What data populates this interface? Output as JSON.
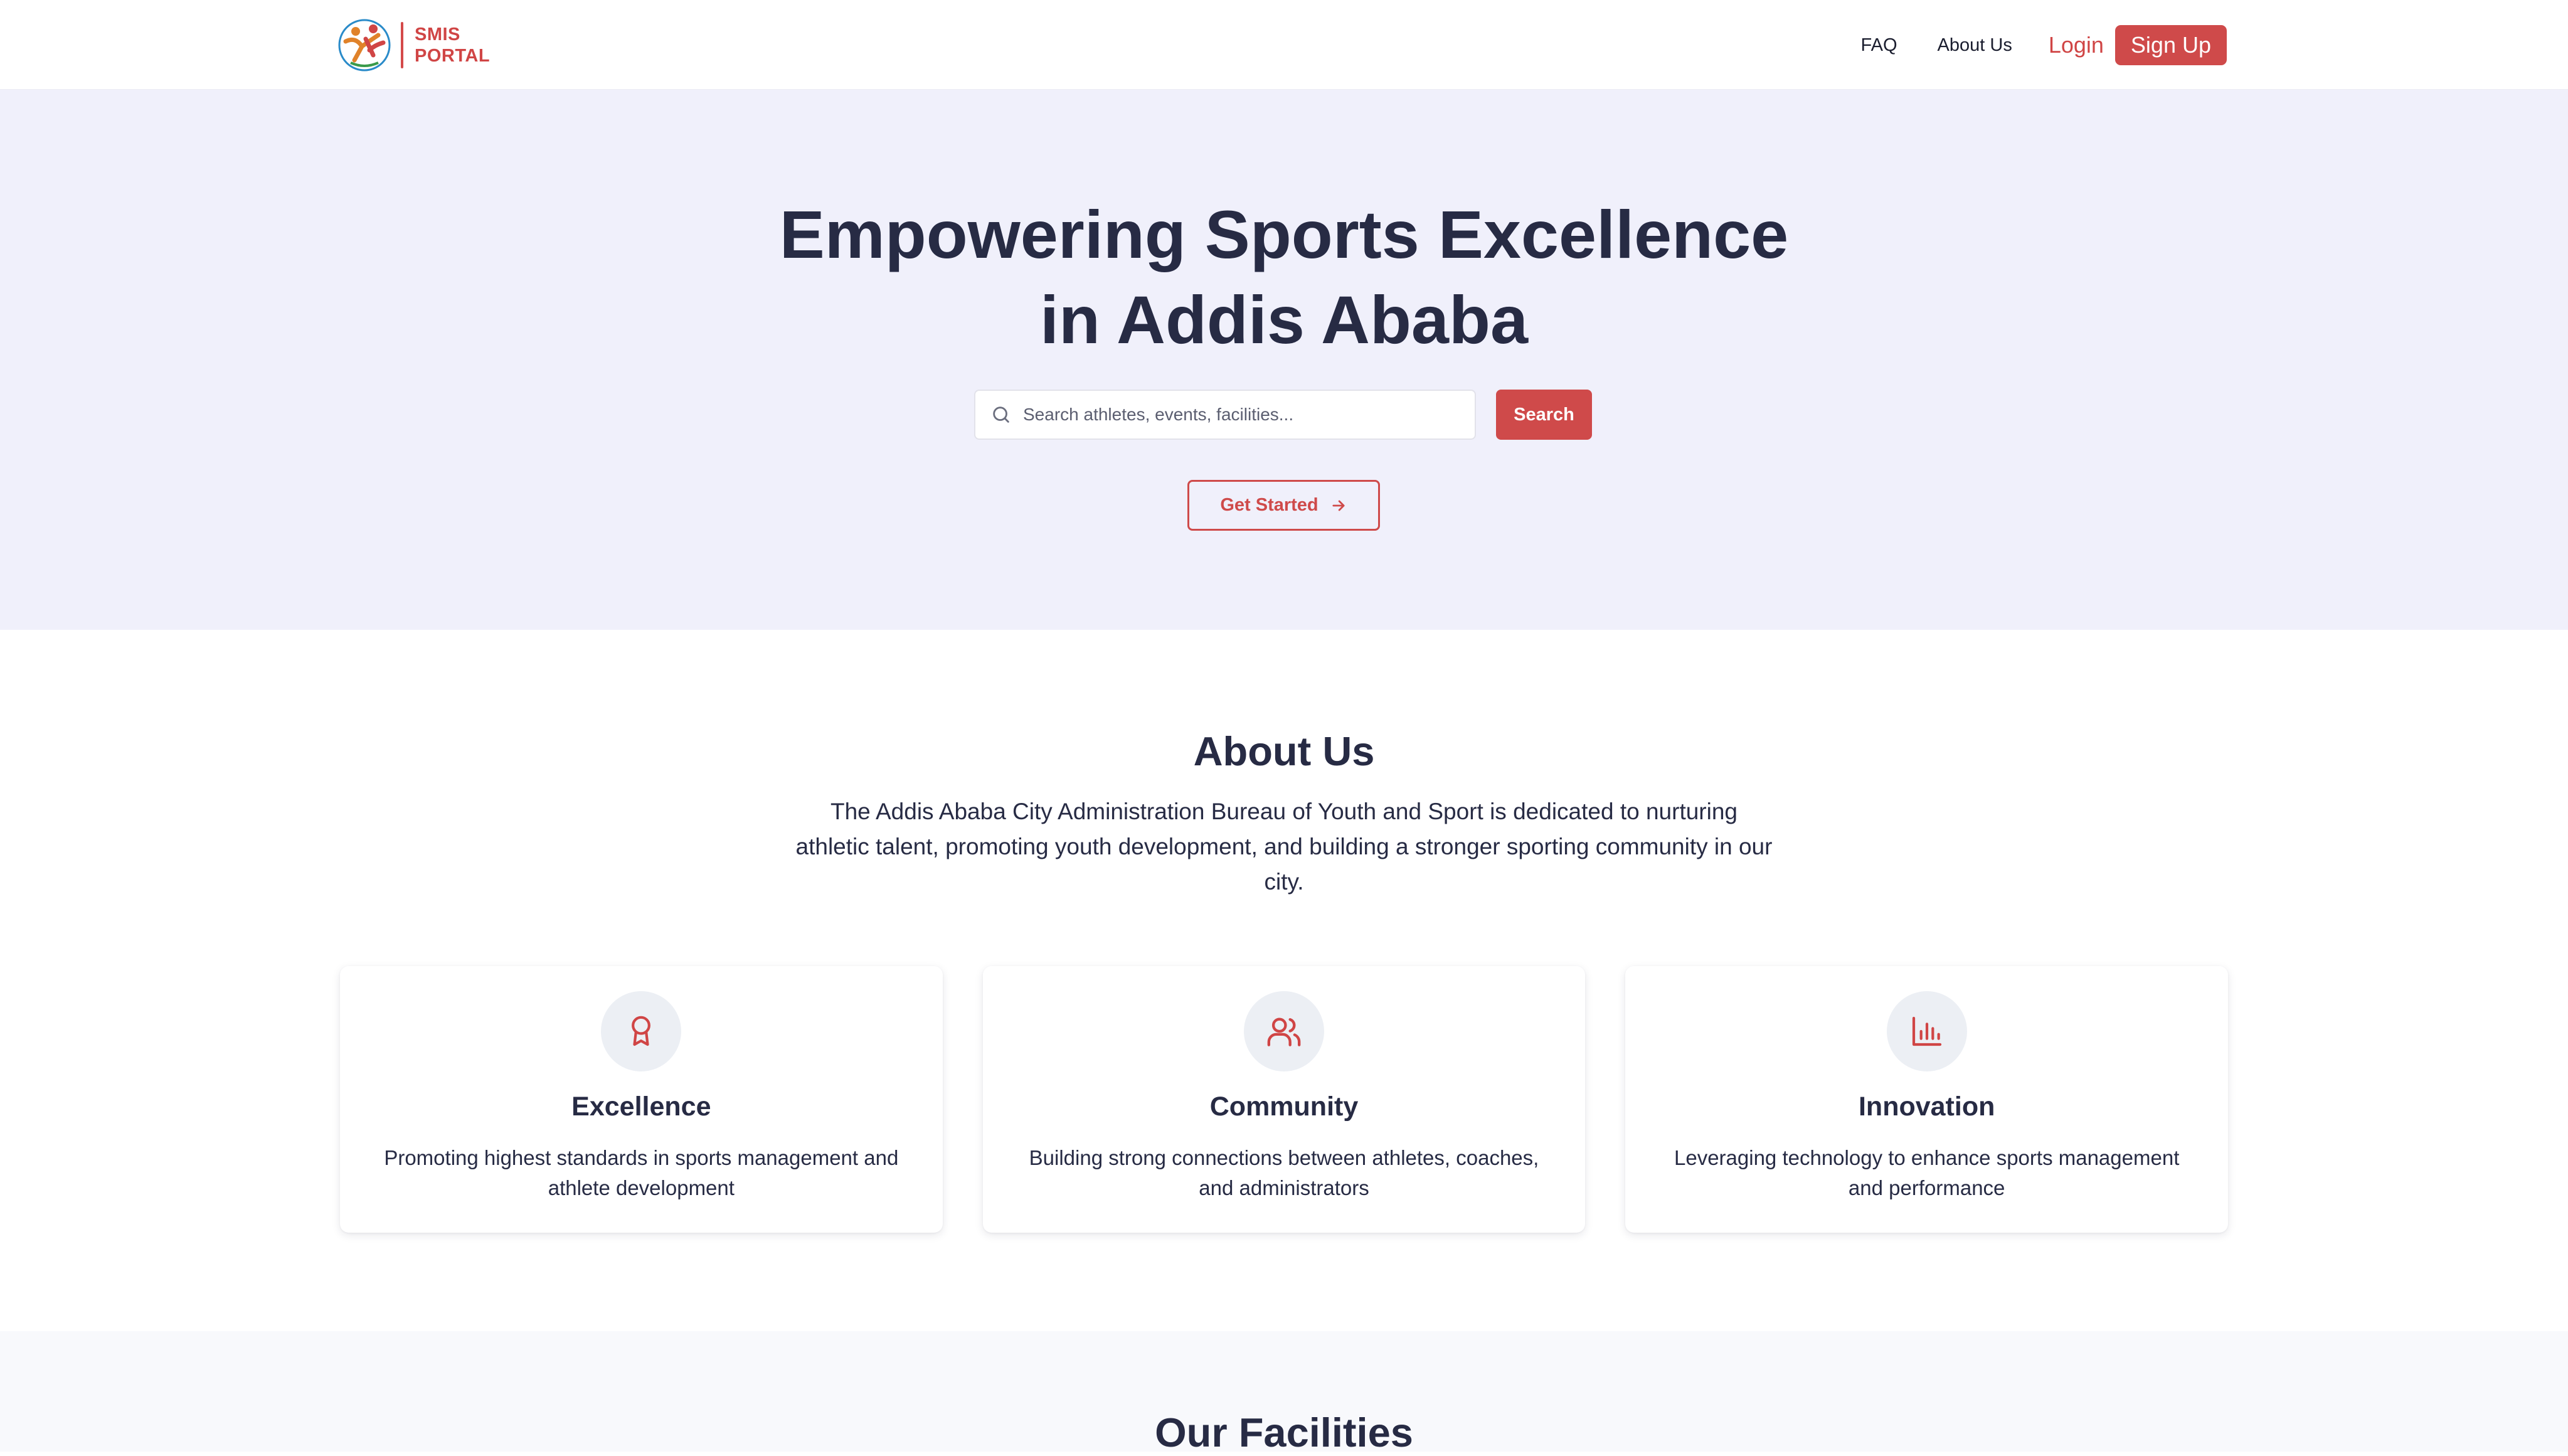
{
  "header": {
    "brand_line1": "SMIS",
    "brand_line2": "PORTAL",
    "nav": {
      "faq": "FAQ",
      "about": "About Us",
      "login": "Login",
      "signup": "Sign Up"
    }
  },
  "hero": {
    "title_line1": "Empowering Sports Excellence",
    "title_line2": "in Addis Ababa",
    "search_placeholder": "Search athletes, events, facilities...",
    "search_value": "",
    "search_button": "Search",
    "get_started": "Get Started"
  },
  "about": {
    "title": "About Us",
    "description": "The Addis Ababa City Administration Bureau of Youth and Sport is dedicated to nurturing athletic talent, promoting youth development, and building a stronger sporting community in our city.",
    "cards": [
      {
        "icon": "award-icon",
        "title": "Excellence",
        "description": "Promoting highest standards in sports management and athlete development"
      },
      {
        "icon": "users-icon",
        "title": "Community",
        "description": "Building strong connections between athletes, coaches, and administrators"
      },
      {
        "icon": "bar-chart-icon",
        "title": "Innovation",
        "description": "Leveraging technology to enhance sports management and performance"
      }
    ]
  },
  "facilities": {
    "title": "Our Facilities"
  },
  "colors": {
    "accent": "#cf4a4a",
    "hero_bg": "#f0f0fb",
    "heading": "#272b44",
    "icon_bg": "#eceff4"
  }
}
